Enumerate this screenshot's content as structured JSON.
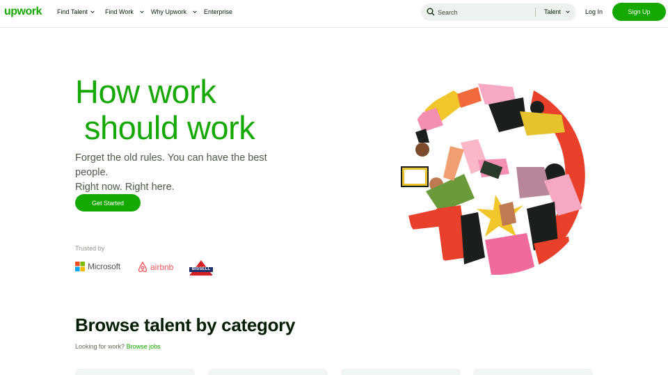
{
  "brand": {
    "logo_text": "upwork",
    "accent_color": "#14a800"
  },
  "nav": {
    "items": [
      {
        "label": "Find Talent",
        "has_dropdown": true
      },
      {
        "label": "Find Work",
        "has_dropdown": true
      },
      {
        "label": "Why Upwork",
        "has_dropdown": true
      },
      {
        "label": "Enterprise",
        "has_dropdown": false
      }
    ],
    "search": {
      "placeholder": "Search",
      "scope": "Talent"
    },
    "login_label": "Log In",
    "signup_label": "Sign Up"
  },
  "hero": {
    "title_line1": "How work",
    "title_line2": "should work",
    "subtitle_line1": "Forget the old rules. You can have the best people.",
    "subtitle_line2": "Right now. Right here.",
    "cta_label": "Get Started",
    "trusted_label": "Trusted by",
    "brands": [
      "Microsoft",
      "airbnb",
      "BISSELL"
    ]
  },
  "categories": {
    "title": "Browse talent by category",
    "prompt": "Looking for work?",
    "link_label": "Browse jobs"
  }
}
